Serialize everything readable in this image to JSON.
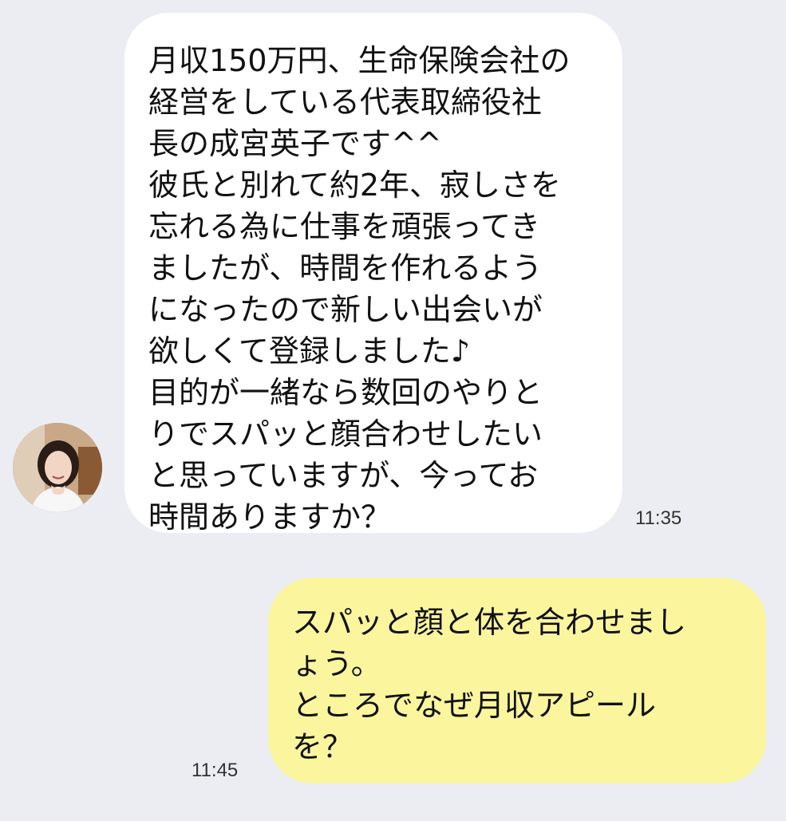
{
  "chat": {
    "messages": [
      {
        "direction": "incoming",
        "text": "月収150万円、生命保険会社の\n経営をしている代表取締役社\n長の成宮英子です^^\n彼氏と別れて約2年、寂しさを\n忘れる為に仕事を頑張ってき\nましたが、時間を作れるよう\nになったので新しい出会いが\n欲しくて登録しました♪\n目的が一緒なら数回のやりと\nりでスパッと顔合わせしたい\nと思っていますが、今ってお\n時間ありますか？",
        "time": "11:35",
        "avatar": "profile-photo-icon"
      },
      {
        "direction": "outgoing",
        "text": "スパッと顔と体を合わせまし\nょう。\nところでなぜ月収アピール\nを？",
        "time": "11:45"
      }
    ]
  },
  "colors": {
    "background": "#ebedf2",
    "incoming_bubble": "#ffffff",
    "outgoing_bubble": "#fbf59d",
    "text": "#111111",
    "timestamp": "#333333"
  }
}
